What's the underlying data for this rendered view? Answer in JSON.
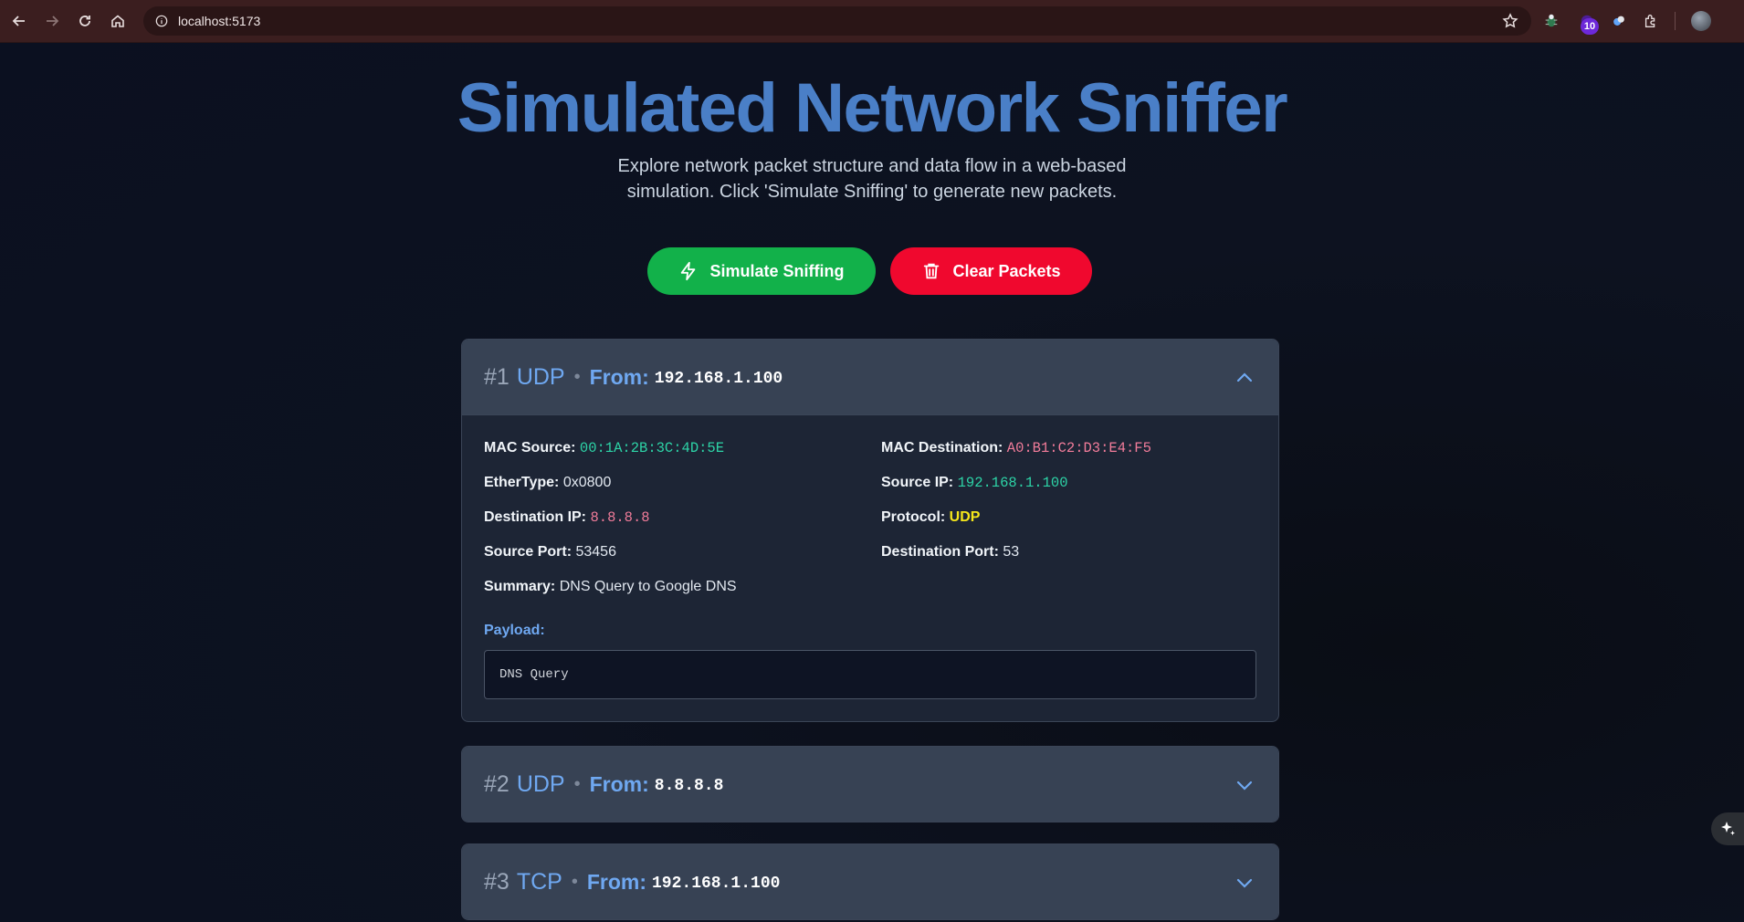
{
  "browser": {
    "url": "localhost:5173",
    "extension_badge": "10"
  },
  "header": {
    "title": "Simulated Network Sniffer",
    "subtitle": "Explore network packet structure and data flow in a web-based simulation. Click 'Simulate Sniffing' to generate new packets."
  },
  "actions": {
    "simulate_label": "Simulate Sniffing",
    "clear_label": "Clear Packets"
  },
  "labels": {
    "from": "From:",
    "mac_source": "MAC Source:",
    "mac_destination": "MAC Destination:",
    "ethertype": "EtherType:",
    "source_ip": "Source IP:",
    "destination_ip": "Destination IP:",
    "protocol": "Protocol:",
    "source_port": "Source Port:",
    "destination_port": "Destination Port:",
    "summary": "Summary:",
    "payload": "Payload:"
  },
  "packets": [
    {
      "number": "#1",
      "protocol": "UDP",
      "from": "192.168.1.100",
      "expanded": true,
      "mac_source": "00:1A:2B:3C:4D:5E",
      "mac_destination": "A0:B1:C2:D3:E4:F5",
      "ethertype": "0x0800",
      "source_ip": "192.168.1.100",
      "destination_ip": "8.8.8.8",
      "protocol_value": "UDP",
      "source_port": "53456",
      "destination_port": "53",
      "summary": "DNS Query to Google DNS",
      "payload": "DNS Query"
    },
    {
      "number": "#2",
      "protocol": "UDP",
      "from": "8.8.8.8",
      "expanded": false
    },
    {
      "number": "#3",
      "protocol": "TCP",
      "from": "192.168.1.100",
      "expanded": false
    }
  ],
  "colors": {
    "title": "#4a7fc7",
    "simulate_button": "#12b14a",
    "clear_button": "#f0082e",
    "accent": "#6fa8f1"
  }
}
